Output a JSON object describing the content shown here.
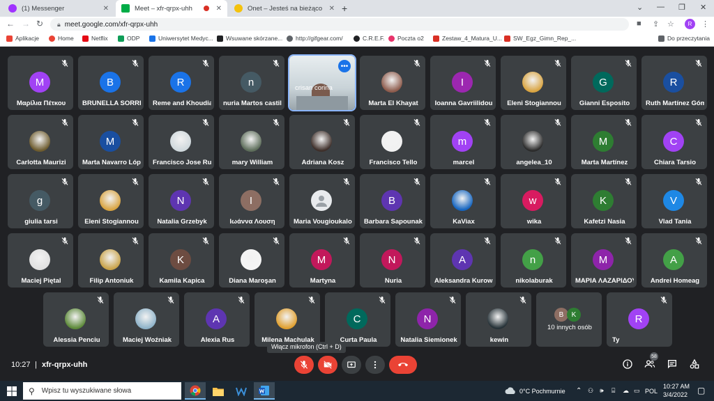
{
  "browser": {
    "tabs": [
      {
        "label": "(1) Messenger",
        "favicon_color": "#a033ff",
        "active": false
      },
      {
        "label": "Meet – xfr-qrpx-uhh",
        "favicon_color": "#00ac47",
        "active": true,
        "recording": true
      },
      {
        "label": "Onet – Jesteś na bieżąco",
        "favicon_color": "#f4c20d",
        "active": false
      }
    ],
    "url": "meet.google.com/xfr-qrpx-uhh",
    "profile_initial": "R",
    "bookmarks": [
      {
        "label": "Aplikacje",
        "color": "#ea4335"
      },
      {
        "label": "Home",
        "color": "#ea4335"
      },
      {
        "label": "Netflix",
        "color": "#e50914"
      },
      {
        "label": "ODP",
        "color": "#0f9d58"
      },
      {
        "label": "Uniwersytet Medyc...",
        "color": "#1a73e8"
      },
      {
        "label": "Wsuwane skórzane...",
        "color": "#202124"
      },
      {
        "label": "http://gifgear.com/",
        "color": "#5f6368"
      },
      {
        "label": "C.R.E.F.",
        "color": "#202124"
      },
      {
        "label": "Poczta o2",
        "color": "#e8336b"
      },
      {
        "label": "Zestaw_4_Matura_U...",
        "color": "#d93025"
      },
      {
        "label": "SW_Egz_Gimn_Rep_...",
        "color": "#d93025"
      }
    ],
    "reading_list": "Do przeczytania"
  },
  "meet": {
    "rows": [
      [
        {
          "name": "Μαρίλια Πέτκου",
          "initial": "M",
          "color": "#a142f4"
        },
        {
          "name": "BRUNELLA SORRENTINO",
          "initial": "B",
          "color": "#1a73e8"
        },
        {
          "name": "Reme and Khoudia",
          "initial": "R",
          "color": "#1a73e8"
        },
        {
          "name": "nuria Martos castillo",
          "initial": "n",
          "color": "#455a64"
        },
        {
          "name": "crisan corina",
          "video": true
        },
        {
          "name": "Marta El Khayat",
          "photo": "#8d5b4c"
        },
        {
          "name": "Ioanna Gavriilidou",
          "initial": "I",
          "color": "#9c27b0"
        },
        {
          "name": "Eleni Stogiannou",
          "photo": "#d9a441"
        },
        {
          "name": "Gianni Esposito",
          "initial": "G",
          "color": "#00695c"
        },
        {
          "name": "Ruth Martínez Gómez",
          "initial": "R",
          "color": "#1a4fa0"
        }
      ],
      [
        {
          "name": "Carlotta Maurizi",
          "photo": "#6d5b2e"
        },
        {
          "name": "Marta Navarro López",
          "initial": "M",
          "color": "#1a4fa0"
        },
        {
          "name": "Francisco Jose Ruiz",
          "photo": "#cfd8dc"
        },
        {
          "name": "mary William",
          "photo": "#5d6d5a"
        },
        {
          "name": "Adriana Kosz",
          "photo": "#3e2f2a"
        },
        {
          "name": "Francisco Tello",
          "photo": "#f1f1f1"
        },
        {
          "name": "marcel",
          "initial": "m",
          "color": "#a142f4"
        },
        {
          "name": "angelea_10",
          "photo": "#2b2b2b"
        },
        {
          "name": "Marta Martínez",
          "initial": "M",
          "color": "#2e7d32"
        },
        {
          "name": "Chiara Tarsio",
          "initial": "C",
          "color": "#a142f4"
        }
      ],
      [
        {
          "name": "giulia tarsi",
          "initial": "g",
          "color": "#455a64"
        },
        {
          "name": "Eleni Stogiannou",
          "photo": "#d9a441"
        },
        {
          "name": "Natalia Grzebyk",
          "initial": "N",
          "color": "#5e35b1"
        },
        {
          "name": "Ιωάννα Λουση",
          "initial": "I",
          "color": "#8d6e63"
        },
        {
          "name": "Maria Vougioukalou",
          "initial": "",
          "color": "#e8eaed"
        },
        {
          "name": "Barbara Sapounaki",
          "initial": "B",
          "color": "#5e35b1"
        },
        {
          "name": "KaViax",
          "photo": "#1565c0"
        },
        {
          "name": "wika",
          "initial": "w",
          "color": "#d81b60"
        },
        {
          "name": "Kafetzi Nasia",
          "initial": "K",
          "color": "#2e7d32"
        },
        {
          "name": "Vlad Tania",
          "initial": "V",
          "color": "#1e88e5"
        }
      ],
      [
        {
          "name": "Maciej Piętal",
          "photo": "#e0e0e0"
        },
        {
          "name": "Filip Antoniuk",
          "photo": "#c9a34a"
        },
        {
          "name": "Kamila Kapica",
          "initial": "K",
          "color": "#6d4c41"
        },
        {
          "name": "Diana Maroşan",
          "photo": "#f5f5f5"
        },
        {
          "name": "Martyna",
          "initial": "M",
          "color": "#c2185b"
        },
        {
          "name": "Nuria",
          "initial": "N",
          "color": "#c2185b"
        },
        {
          "name": "Aleksandra Kurowska",
          "initial": "A",
          "color": "#5e35b1"
        },
        {
          "name": "nikolaburak",
          "initial": "n",
          "color": "#43a047"
        },
        {
          "name": "ΜΑΡΙΑ ΛΑΖΑΡΙΔΟΥ",
          "initial": "M",
          "color": "#8e24aa"
        },
        {
          "name": "Andrei Homeag",
          "initial": "A",
          "color": "#43a047"
        }
      ],
      [
        {
          "name": "Alessia Penciu",
          "photo": "#5d8a3a"
        },
        {
          "name": "Maciej Woźniak",
          "photo": "#8fb3c9"
        },
        {
          "name": "Alexia Rus",
          "initial": "A",
          "color": "#5e35b1"
        },
        {
          "name": "Milena Machulak",
          "photo": "#e0a030"
        },
        {
          "name": "Curta Paula",
          "initial": "C",
          "color": "#00695c"
        },
        {
          "name": "Natalia Siemionek",
          "initial": "N",
          "color": "#8e24aa"
        },
        {
          "name": "kewin",
          "photo": "#263238"
        },
        {
          "name": "10 innych osób",
          "others": [
            "B",
            "K"
          ],
          "others_colors": [
            "#8d6e63",
            "#2e7d32"
          ]
        },
        {
          "name": "Ty",
          "initial": "R",
          "color": "#a142f4"
        }
      ]
    ],
    "time": "10:27",
    "separator": "|",
    "meeting_code": "xfr-qrpx-uhh",
    "tooltip": "Włącz mikrofon (Ctrl + D)",
    "participants_count": "58"
  },
  "taskbar": {
    "search_placeholder": "Wpisz tu wyszukiwane słowa",
    "weather": "0°C Pochmurnie",
    "language": "POL",
    "time": "10:27 AM",
    "date": "3/4/2022"
  }
}
